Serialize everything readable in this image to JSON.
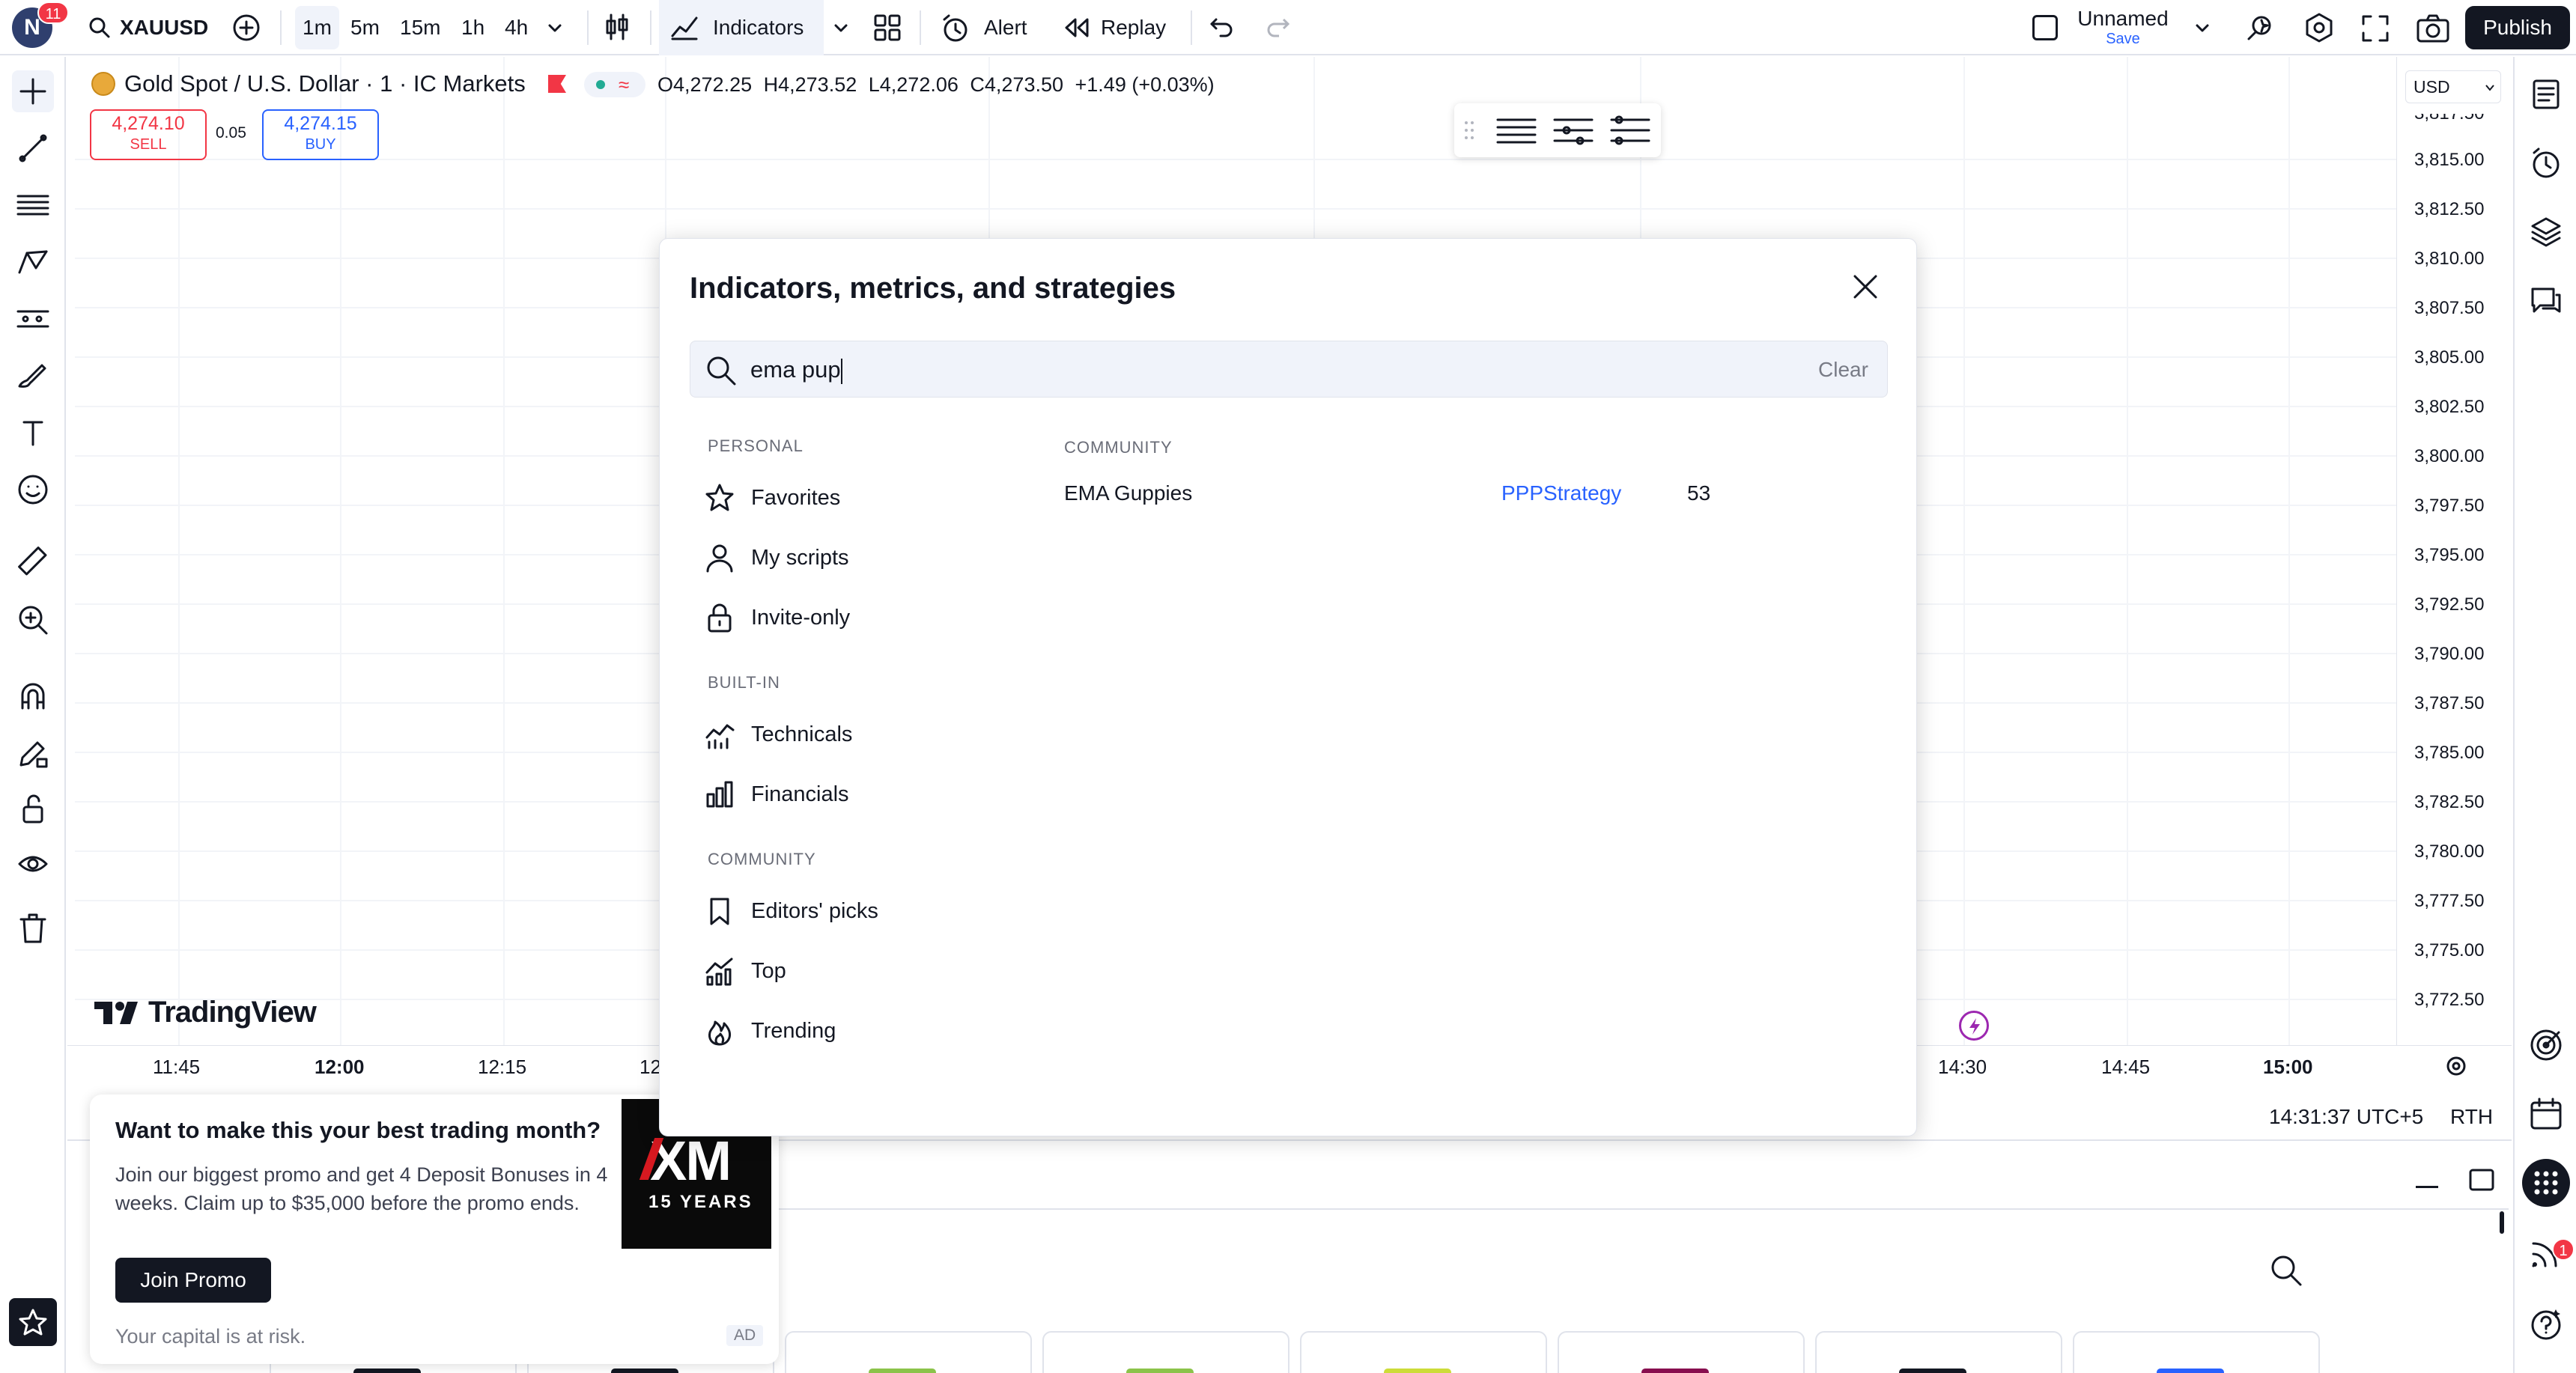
{
  "header": {
    "avatar_letter": "N",
    "notification_count": "11",
    "symbol": "XAUUSD",
    "timeframes": [
      "1m",
      "5m",
      "15m",
      "1h",
      "4h"
    ],
    "active_timeframe": "1m",
    "indicators_label": "Indicators",
    "alert_label": "Alert",
    "replay_label": "Replay",
    "layout_name": "Unnamed",
    "layout_save": "Save",
    "publish_label": "Publish"
  },
  "legend": {
    "title": "Gold Spot / U.S. Dollar · 1 · IC Markets",
    "open": "O4,272.25",
    "high": "H4,273.52",
    "low": "L4,272.06",
    "close": "C4,273.50",
    "change": "+1.49 (+0.03%)",
    "sell_price": "4,274.10",
    "sell_label": "SELL",
    "spread": "0.05",
    "buy_price": "4,274.15",
    "buy_label": "BUY"
  },
  "price_axis": {
    "currency": "USD",
    "top_partial": "3,817.50",
    "labels": [
      "3,815.00",
      "3,812.50",
      "3,810.00",
      "3,807.50",
      "3,805.00",
      "3,802.50",
      "3,800.00",
      "3,797.50",
      "3,795.00",
      "3,792.50",
      "3,790.00",
      "3,787.50",
      "3,785.00",
      "3,782.50",
      "3,780.00",
      "3,777.50",
      "3,775.00",
      "3,772.50"
    ]
  },
  "time_axis": {
    "labels": [
      {
        "text": "11:45",
        "bold": false
      },
      {
        "text": "12:00",
        "bold": true
      },
      {
        "text": "12:15",
        "bold": false
      },
      {
        "text": "12",
        "bold": false
      },
      {
        "text": "14:30",
        "bold": false
      },
      {
        "text": "14:45",
        "bold": false
      },
      {
        "text": "15:00",
        "bold": true
      }
    ]
  },
  "status": {
    "clock": "14:31:37 UTC+5",
    "session": "RTH"
  },
  "watermark": "TradingView",
  "dialog": {
    "title": "Indicators, metrics, and strategies",
    "search_value": "ema pup",
    "clear_label": "Clear",
    "sections": [
      {
        "header": "PERSONAL",
        "items": [
          {
            "label": "Favorites",
            "icon": "star-icon"
          },
          {
            "label": "My scripts",
            "icon": "user-icon"
          },
          {
            "label": "Invite-only",
            "icon": "lock-icon"
          }
        ]
      },
      {
        "header": "BUILT-IN",
        "items": [
          {
            "label": "Technicals",
            "icon": "technicals-chart-icon"
          },
          {
            "label": "Financials",
            "icon": "bar-chart-icon"
          }
        ]
      },
      {
        "header": "COMMUNITY",
        "items": [
          {
            "label": "Editors' picks",
            "icon": "bookmark-icon"
          },
          {
            "label": "Top",
            "icon": "top-chart-icon"
          },
          {
            "label": "Trending",
            "icon": "fire-icon"
          }
        ]
      }
    ],
    "results_header": "COMMUNITY",
    "results": [
      {
        "name": "EMA Guppies",
        "author": "PPPStrategy",
        "boosts": "53"
      }
    ]
  },
  "promo": {
    "title": "Want to make this your best trading month?",
    "body": "Join our biggest promo and get 4 Deposit Bonuses in 4 weeks. Claim up to $35,000 before the promo ends.",
    "button": "Join Promo",
    "footer": "Your capital is at risk.",
    "ad_badge": "AD",
    "logo_text": "XM",
    "logo_sub": "15 YEARS"
  },
  "right_panel": {
    "notification_count": "1"
  },
  "colors": {
    "sell": "#f23645",
    "buy": "#2962ff",
    "link": "#2962ff",
    "publish_bg": "#131722",
    "avatar_bg": "#2f3f6e",
    "badge": "#f23645",
    "accent_purple": "#9c27b0"
  }
}
